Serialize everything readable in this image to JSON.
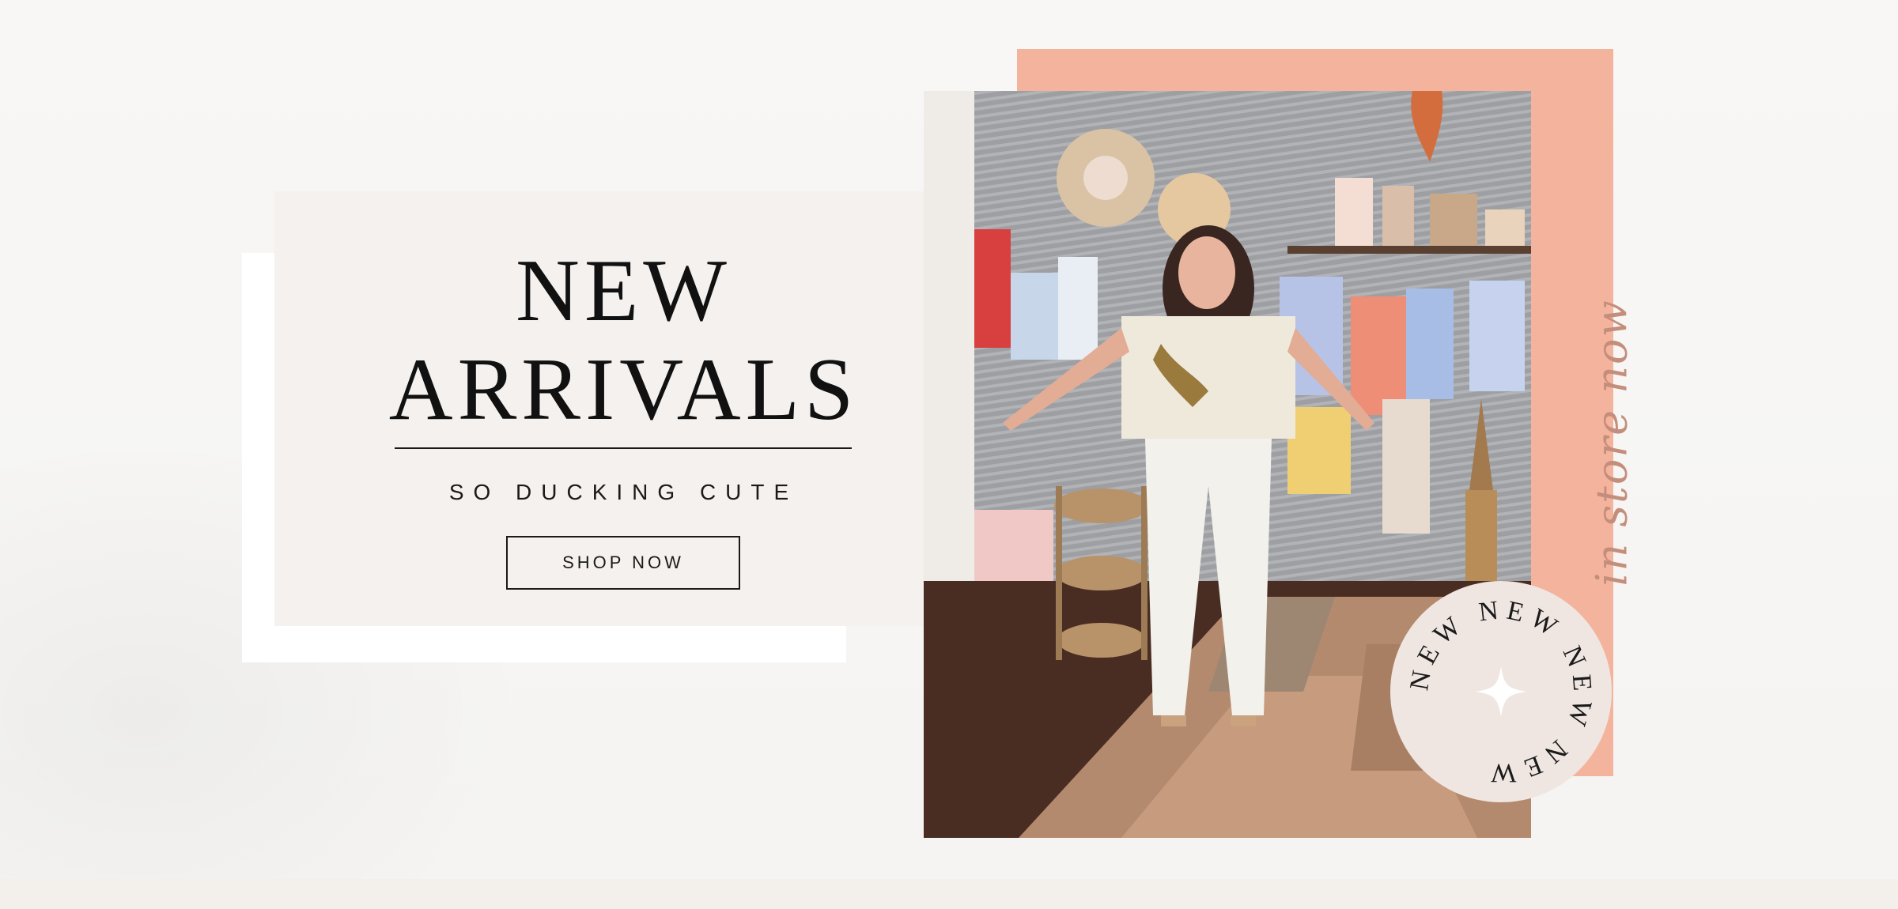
{
  "hero": {
    "title_line1": "NEW",
    "title_line2": "ARRIVALS",
    "tagline": "SO DUCKING CUTE",
    "cta_label": "SHOP NOW"
  },
  "side_text": "in store now",
  "badge": {
    "ring_text": "NEW NEW NEW NEW",
    "center_icon": "sparkle-icon"
  },
  "photo": {
    "subject": "woman-in-boutique"
  },
  "colors": {
    "accent_salmon": "#f4b39c",
    "card_bg": "#f4f1ee",
    "text_dark": "#111111",
    "script_color": "#c48e7c",
    "badge_bg": "#efe6e1"
  }
}
